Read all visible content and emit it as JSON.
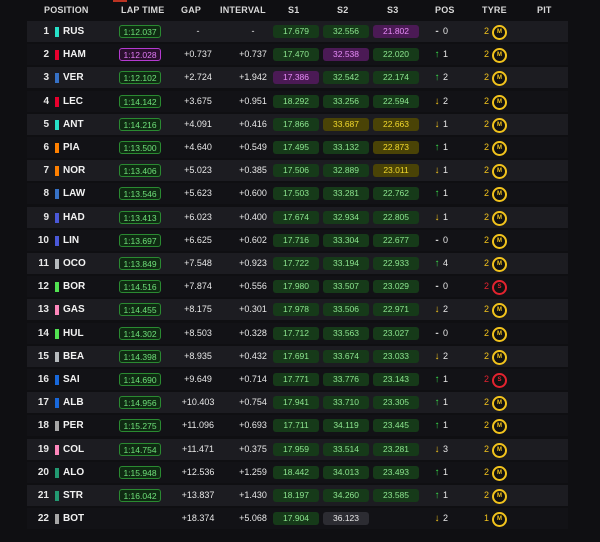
{
  "headers": {
    "position": "POSITION",
    "lap_time": "LAP TIME",
    "gap": "GAP",
    "interval": "INTERVAL",
    "s1": "S1",
    "s2": "S2",
    "s3": "S3",
    "pos": "POS",
    "tyre": "TYRE",
    "pit": "PIT"
  },
  "colors": {
    "green": "#8ce68f",
    "yellow": "#f3da2c",
    "purple": "#e88cf9",
    "medium_tyre": "#f2c31c",
    "soft_tyre": "#e3232f"
  },
  "rows": [
    {
      "pos": "1",
      "code": "RUS",
      "team": "#27e1c8",
      "lap": "1:12.037",
      "lap_style": "green",
      "gap": "-",
      "int": "-",
      "s1": "17.679",
      "s1c": "green",
      "s2": "32.556",
      "s2c": "green",
      "s3": "21.802",
      "s3c": "purple",
      "dir": "same",
      "chg": "0",
      "laps": "2",
      "tyre": "M"
    },
    {
      "pos": "2",
      "code": "HAM",
      "team": "#e8002d",
      "lap": "1:12.028",
      "lap_style": "purple",
      "gap": "+0.737",
      "int": "+0.737",
      "s1": "17.470",
      "s1c": "green",
      "s2": "32.538",
      "s2c": "purple",
      "s3": "22.020",
      "s3c": "green",
      "dir": "up",
      "chg": "1",
      "laps": "2",
      "tyre": "M"
    },
    {
      "pos": "3",
      "code": "VER",
      "team": "#3671c6",
      "lap": "1:12.102",
      "lap_style": "green",
      "gap": "+2.724",
      "int": "+1.942",
      "s1": "17.386",
      "s1c": "purple",
      "s2": "32.542",
      "s2c": "green",
      "s3": "22.174",
      "s3c": "green",
      "dir": "up",
      "chg": "2",
      "laps": "2",
      "tyre": "M"
    },
    {
      "pos": "4",
      "code": "LEC",
      "team": "#e8002d",
      "lap": "1:14.142",
      "lap_style": "green",
      "gap": "+3.675",
      "int": "+0.951",
      "s1": "18.292",
      "s1c": "green",
      "s2": "33.256",
      "s2c": "green",
      "s3": "22.594",
      "s3c": "green",
      "dir": "down",
      "chg": "2",
      "laps": "2",
      "tyre": "M"
    },
    {
      "pos": "5",
      "code": "ANT",
      "team": "#27e1c8",
      "lap": "1:14.216",
      "lap_style": "green",
      "gap": "+4.091",
      "int": "+0.416",
      "s1": "17.866",
      "s1c": "green",
      "s2": "33.687",
      "s2c": "yellow",
      "s3": "22.663",
      "s3c": "yellow",
      "dir": "down",
      "chg": "1",
      "laps": "2",
      "tyre": "M"
    },
    {
      "pos": "6",
      "code": "PIA",
      "team": "#ff8000",
      "lap": "1:13.500",
      "lap_style": "green",
      "gap": "+4.640",
      "int": "+0.549",
      "s1": "17.495",
      "s1c": "green",
      "s2": "33.132",
      "s2c": "green",
      "s3": "22.873",
      "s3c": "yellow",
      "dir": "up",
      "chg": "1",
      "laps": "2",
      "tyre": "M"
    },
    {
      "pos": "7",
      "code": "NOR",
      "team": "#ff8000",
      "lap": "1:13.406",
      "lap_style": "green",
      "gap": "+5.023",
      "int": "+0.385",
      "s1": "17.506",
      "s1c": "green",
      "s2": "32.889",
      "s2c": "green",
      "s3": "23.011",
      "s3c": "yellow",
      "dir": "down",
      "chg": "1",
      "laps": "2",
      "tyre": "M"
    },
    {
      "pos": "8",
      "code": "LAW",
      "team": "#3671c6",
      "lap": "1:13.546",
      "lap_style": "green",
      "gap": "+5.623",
      "int": "+0.600",
      "s1": "17.503",
      "s1c": "green",
      "s2": "33.281",
      "s2c": "green",
      "s3": "22.762",
      "s3c": "green",
      "dir": "up",
      "chg": "1",
      "laps": "2",
      "tyre": "M"
    },
    {
      "pos": "9",
      "code": "HAD",
      "team": "#4a58d8",
      "lap": "1:13.413",
      "lap_style": "green",
      "gap": "+6.023",
      "int": "+0.400",
      "s1": "17.674",
      "s1c": "green",
      "s2": "32.934",
      "s2c": "green",
      "s3": "22.805",
      "s3c": "green",
      "dir": "down",
      "chg": "1",
      "laps": "2",
      "tyre": "M"
    },
    {
      "pos": "10",
      "code": "LIN",
      "team": "#4a58d8",
      "lap": "1:13.697",
      "lap_style": "green",
      "gap": "+6.625",
      "int": "+0.602",
      "s1": "17.716",
      "s1c": "green",
      "s2": "33.304",
      "s2c": "green",
      "s3": "22.677",
      "s3c": "green",
      "dir": "same",
      "chg": "0",
      "laps": "2",
      "tyre": "M"
    },
    {
      "pos": "11",
      "code": "OCO",
      "team": "#b6babd",
      "lap": "1:13.849",
      "lap_style": "green",
      "gap": "+7.548",
      "int": "+0.923",
      "s1": "17.722",
      "s1c": "green",
      "s2": "33.194",
      "s2c": "green",
      "s3": "22.933",
      "s3c": "green",
      "dir": "up",
      "chg": "4",
      "laps": "2",
      "tyre": "M"
    },
    {
      "pos": "12",
      "code": "BOR",
      "team": "#52e252",
      "lap": "1:14.516",
      "lap_style": "green",
      "gap": "+7.874",
      "int": "+0.556",
      "s1": "17.980",
      "s1c": "green",
      "s2": "33.507",
      "s2c": "green",
      "s3": "23.029",
      "s3c": "green",
      "dir": "same",
      "chg": "0",
      "laps": "2",
      "tyre": "S"
    },
    {
      "pos": "13",
      "code": "GAS",
      "team": "#ff87bc",
      "lap": "1:14.455",
      "lap_style": "green",
      "gap": "+8.175",
      "int": "+0.301",
      "s1": "17.978",
      "s1c": "green",
      "s2": "33.506",
      "s2c": "green",
      "s3": "22.971",
      "s3c": "green",
      "dir": "down",
      "chg": "2",
      "laps": "2",
      "tyre": "M"
    },
    {
      "pos": "14",
      "code": "HUL",
      "team": "#52e252",
      "lap": "1:14.302",
      "lap_style": "green",
      "gap": "+8.503",
      "int": "+0.328",
      "s1": "17.712",
      "s1c": "green",
      "s2": "33.563",
      "s2c": "green",
      "s3": "23.027",
      "s3c": "green",
      "dir": "same",
      "chg": "0",
      "laps": "2",
      "tyre": "M"
    },
    {
      "pos": "15",
      "code": "BEA",
      "team": "#b6babd",
      "lap": "1:14.398",
      "lap_style": "green",
      "gap": "+8.935",
      "int": "+0.432",
      "s1": "17.691",
      "s1c": "green",
      "s2": "33.674",
      "s2c": "green",
      "s3": "23.033",
      "s3c": "green",
      "dir": "down",
      "chg": "2",
      "laps": "2",
      "tyre": "M"
    },
    {
      "pos": "16",
      "code": "SAI",
      "team": "#1868db",
      "lap": "1:14.690",
      "lap_style": "green",
      "gap": "+9.649",
      "int": "+0.714",
      "s1": "17.771",
      "s1c": "green",
      "s2": "33.776",
      "s2c": "green",
      "s3": "23.143",
      "s3c": "green",
      "dir": "up",
      "chg": "1",
      "laps": "2",
      "tyre": "S"
    },
    {
      "pos": "17",
      "code": "ALB",
      "team": "#1868db",
      "lap": "1:14.956",
      "lap_style": "green",
      "gap": "+10.403",
      "int": "+0.754",
      "s1": "17.941",
      "s1c": "green",
      "s2": "33.710",
      "s2c": "green",
      "s3": "23.305",
      "s3c": "green",
      "dir": "up",
      "chg": "1",
      "laps": "2",
      "tyre": "M"
    },
    {
      "pos": "18",
      "code": "PER",
      "team": "#a6a6a6",
      "lap": "1:15.275",
      "lap_style": "green",
      "gap": "+11.096",
      "int": "+0.693",
      "s1": "17.711",
      "s1c": "green",
      "s2": "34.119",
      "s2c": "green",
      "s3": "23.445",
      "s3c": "green",
      "dir": "up",
      "chg": "1",
      "laps": "2",
      "tyre": "M"
    },
    {
      "pos": "19",
      "code": "COL",
      "team": "#ff87bc",
      "lap": "1:14.754",
      "lap_style": "green",
      "gap": "+11.471",
      "int": "+0.375",
      "s1": "17.959",
      "s1c": "green",
      "s2": "33.514",
      "s2c": "green",
      "s3": "23.281",
      "s3c": "green",
      "dir": "down",
      "chg": "3",
      "laps": "2",
      "tyre": "M"
    },
    {
      "pos": "20",
      "code": "ALO",
      "team": "#229971",
      "lap": "1:15.948",
      "lap_style": "green",
      "gap": "+12.536",
      "int": "+1.259",
      "s1": "18.442",
      "s1c": "green",
      "s2": "34.013",
      "s2c": "green",
      "s3": "23.493",
      "s3c": "green",
      "dir": "up",
      "chg": "1",
      "laps": "2",
      "tyre": "M"
    },
    {
      "pos": "21",
      "code": "STR",
      "team": "#229971",
      "lap": "1:16.042",
      "lap_style": "green",
      "gap": "+13.837",
      "int": "+1.430",
      "s1": "18.197",
      "s1c": "green",
      "s2": "34.260",
      "s2c": "green",
      "s3": "23.585",
      "s3c": "green",
      "dir": "up",
      "chg": "1",
      "laps": "2",
      "tyre": "M"
    },
    {
      "pos": "22",
      "code": "BOT",
      "team": "#a6a6a6",
      "lap": "",
      "lap_style": "none",
      "gap": "+18.374",
      "int": "+5.068",
      "s1": "17.904",
      "s1c": "green",
      "s2": "36.123",
      "s2c": "white",
      "s3": "",
      "s3c": "none",
      "dir": "down",
      "chg": "2",
      "laps": "1",
      "tyre": "M"
    }
  ]
}
